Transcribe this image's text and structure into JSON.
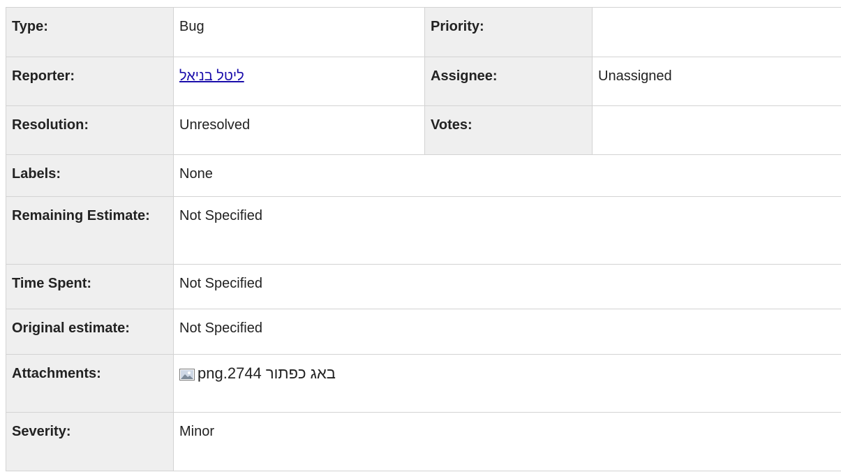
{
  "rows": {
    "type": {
      "label": "Type:",
      "value": "Bug"
    },
    "priority": {
      "label": "Priority:",
      "value": ""
    },
    "reporter": {
      "label": "Reporter:",
      "value": "ליטל בניאל"
    },
    "assignee": {
      "label": "Assignee:",
      "value": "Unassigned"
    },
    "resolution": {
      "label": "Resolution:",
      "value": "Unresolved"
    },
    "votes": {
      "label": "Votes:",
      "value": ""
    },
    "labels": {
      "label": "Labels:",
      "value": "None"
    },
    "remaining_estimate": {
      "label": "Remaining Estimate:",
      "value": "Not Specified"
    },
    "time_spent": {
      "label": "Time Spent:",
      "value": "Not Specified"
    },
    "original_estimate": {
      "label": "Original estimate:",
      "value": "Not Specified"
    },
    "attachments": {
      "label": "Attachments:",
      "file_name": "באג כפתור 2744.png",
      "icon": "image-icon"
    },
    "severity": {
      "label": "Severity:",
      "value": "Minor"
    }
  },
  "colors": {
    "label_bg": "#efefef",
    "border": "#d3d3d3",
    "link": "#1a0dab"
  }
}
